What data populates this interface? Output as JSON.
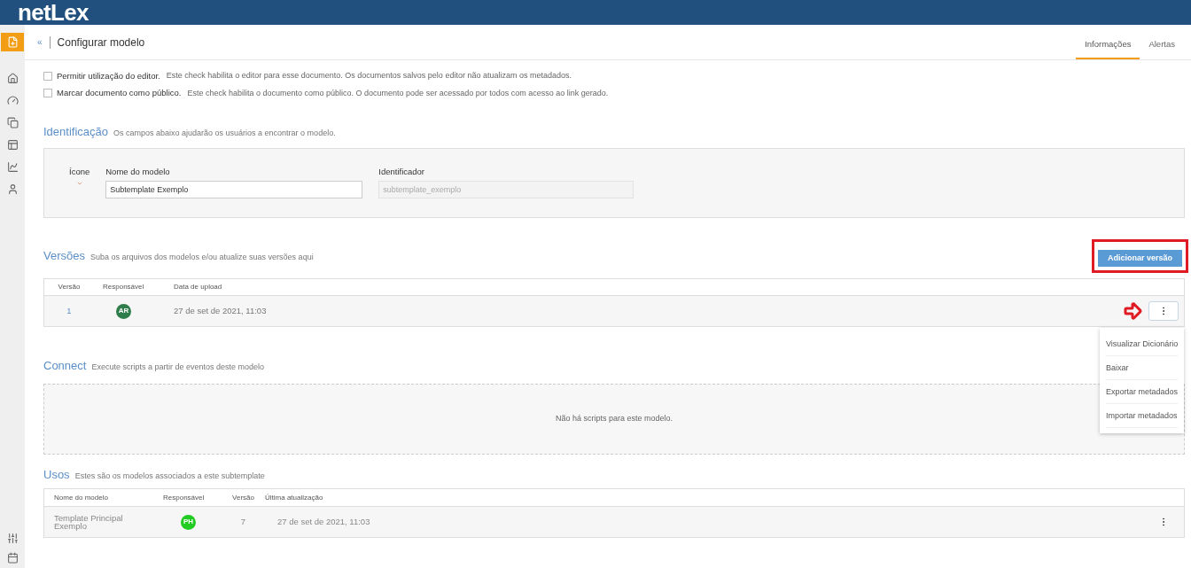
{
  "header": {
    "logo": "netLex"
  },
  "sidebar": {
    "items": [
      {
        "selected": true
      },
      {
        "selected": false
      },
      {
        "selected": false
      },
      {
        "selected": false
      },
      {
        "selected": false
      },
      {
        "selected": false
      },
      {
        "selected": false
      }
    ],
    "bottom_items": [
      {
        "selected": false
      },
      {
        "selected": false
      }
    ]
  },
  "page": {
    "back": "«",
    "title": "Configurar modelo",
    "tabs": [
      {
        "label": "Informações",
        "selected": true
      },
      {
        "label": "Alertas",
        "selected": false
      }
    ]
  },
  "options": [
    {
      "label": "Permitir utilização do editor.",
      "description": "Este check habilita o editor para esse documento. Os documentos salvos pelo editor não atualizam os metadados.",
      "checked": false
    },
    {
      "label": "Marcar documento como público.",
      "description": "Este check habilita o documento como público. O documento pode ser acessado por todos com acesso ao link gerado.",
      "checked": false
    }
  ],
  "identification": {
    "title": "Identificação",
    "subtitle": "Os campos abaixo ajudarão os usuários a encontrar o modelo.",
    "icon_label": "Ícone",
    "fields": [
      {
        "label": "Nome do modelo",
        "value": "Subtemplate Exemplo",
        "disabled": false
      },
      {
        "label": "Identificador",
        "value": "subtemplate_exemplo",
        "disabled": true
      }
    ]
  },
  "versions": {
    "title": "Versões",
    "subtitle": "Suba os arquivos dos modelos e/ou atualize suas versões aqui",
    "button": "Adicionar versão",
    "columns": [
      "Versão",
      "Responsável",
      "Data de upload"
    ],
    "rows": [
      {
        "version": "1",
        "initials": "AR",
        "color": "#2e7d4a",
        "date": "27 de set de 2021, 11:03"
      }
    ],
    "menu": [
      "Visualizar Dicionário",
      "Baixar",
      "Exportar metadados",
      "Importar metadados"
    ]
  },
  "connect": {
    "title": "Connect",
    "subtitle": "Execute scripts a partir de eventos deste modelo",
    "empty": "Não há scripts para este modelo."
  },
  "uses": {
    "title": "Usos",
    "subtitle": "Estes são os modelos associados a este subtemplate",
    "columns": [
      "Nome do modelo",
      "Responsável",
      "Versão",
      "Última atualização"
    ],
    "rows": [
      {
        "name": "Template Principal Exemplo",
        "initials": "PH",
        "color": "#22cc22",
        "version": "7",
        "date": "27 de set de 2021, 11:03"
      }
    ]
  }
}
